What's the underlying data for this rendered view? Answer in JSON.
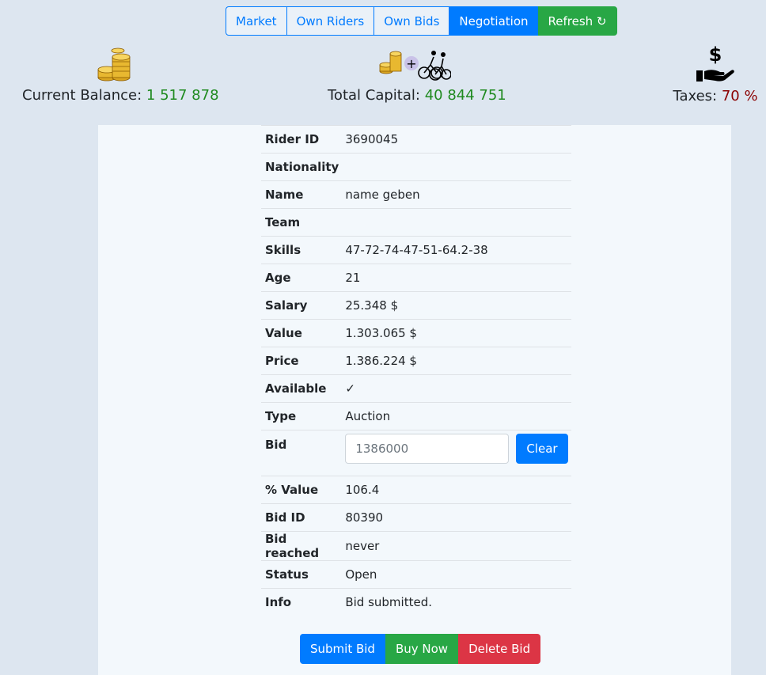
{
  "nav": {
    "tabs": [
      {
        "label": "Market",
        "active": false
      },
      {
        "label": "Own Riders",
        "active": false
      },
      {
        "label": "Own Bids",
        "active": false
      },
      {
        "label": "Negotiation",
        "active": true
      }
    ],
    "refresh_label": "Refresh ↻"
  },
  "stats": {
    "balance": {
      "label": "Current Balance:",
      "value": "1 517 878",
      "icon": "coins-icon"
    },
    "capital": {
      "label": "Total Capital:",
      "value": "40 844 751",
      "icon": "coins-plus-riders-icon"
    },
    "taxes": {
      "label": "Taxes:",
      "value": "70 %",
      "icon": "hand-dollar-icon"
    }
  },
  "rider": {
    "rows": [
      {
        "key": "Rider ID",
        "value": "3690045"
      },
      {
        "key": "Nationality",
        "value": ""
      },
      {
        "key": "Name",
        "value": "name geben"
      },
      {
        "key": "Team",
        "value": ""
      },
      {
        "key": "Skills",
        "value": "47-72-74-47-51-64.2-38"
      },
      {
        "key": "Age",
        "value": "21"
      },
      {
        "key": "Salary",
        "value": "25.348 $"
      },
      {
        "key": "Value",
        "value": "1.303.065 $"
      },
      {
        "key": "Price",
        "value": "1.386.224 $"
      },
      {
        "key": "Available",
        "value": "✓"
      },
      {
        "key": "Type",
        "value": "Auction"
      }
    ],
    "bid": {
      "key": "Bid",
      "value": "1386000",
      "clear_label": "Clear"
    },
    "rows2": [
      {
        "key": "% Value",
        "value": "106.4"
      },
      {
        "key": "Bid ID",
        "value": "80390"
      },
      {
        "key": "Bid reached",
        "value": "never"
      },
      {
        "key": "Status",
        "value": "Open"
      },
      {
        "key": "Info",
        "value": "Bid submitted."
      }
    ]
  },
  "actions": {
    "submit_label": "Submit Bid",
    "buy_label": "Buy Now",
    "delete_label": "Delete Bid"
  },
  "colors": {
    "primary": "#007bff",
    "success": "#28a745",
    "danger": "#dc3545",
    "value_green": "#1f8a1f",
    "tax_red": "#8b0000"
  }
}
